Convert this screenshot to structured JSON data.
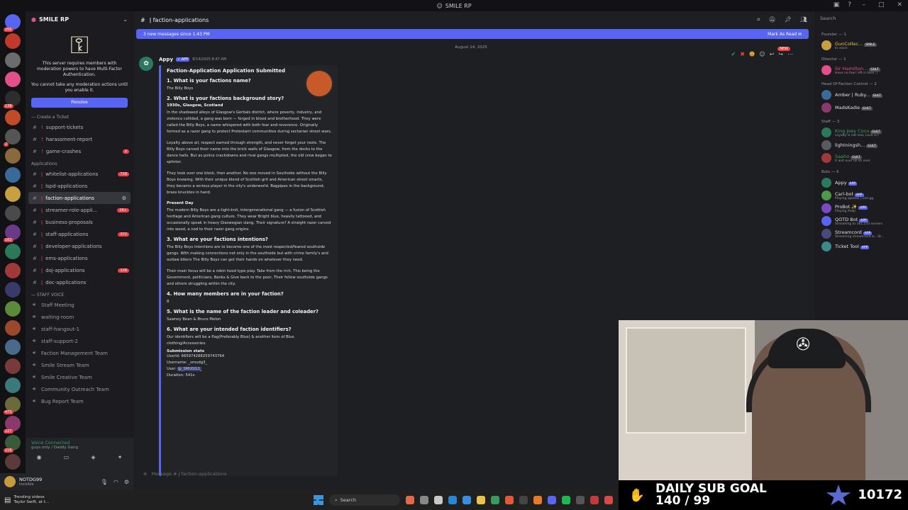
{
  "window": {
    "title": "SMILE RP"
  },
  "rail": {
    "servers": [
      {
        "badge": "250"
      },
      {
        "badge": ""
      },
      {
        "badge": ""
      },
      {
        "badge": ""
      },
      {
        "badge": "138"
      },
      {
        "badge": ""
      },
      {
        "badge": "2"
      },
      {
        "badge": ""
      },
      {
        "badge": ""
      },
      {
        "badge": ""
      },
      {
        "badge": ""
      },
      {
        "badge": "162"
      },
      {
        "badge": ""
      },
      {
        "badge": ""
      },
      {
        "badge": ""
      },
      {
        "badge": ""
      },
      {
        "badge": ""
      },
      {
        "badge": ""
      },
      {
        "badge": ""
      },
      {
        "badge": ""
      },
      {
        "badge": "473"
      },
      {
        "badge": "227"
      },
      {
        "badge": "216"
      },
      {
        "badge": ""
      }
    ]
  },
  "sidebar": {
    "server_name": "SMILE RP",
    "mfa_text_1": "This server requires members with moderation powers to have Multi-Factor Authentication.",
    "mfa_text_2": "You cannot take any moderation actions until you enable it.",
    "resolve_label": "Resolve",
    "cat_ticket": "Create a Ticket",
    "ticket_channels": [
      {
        "name": "support-tickets",
        "badge": ""
      },
      {
        "name": "harassment-report",
        "badge": ""
      },
      {
        "name": "game-crashes",
        "badge": "2"
      }
    ],
    "cat_apps": "Applications",
    "app_channels": [
      {
        "name": "whitelist-applications",
        "badge": "728"
      },
      {
        "name": "lspd-applications",
        "badge": ""
      },
      {
        "name": "faction-applications",
        "badge": ""
      },
      {
        "name": "streamer-role-appli...",
        "badge": "1K+"
      },
      {
        "name": "business-proposals",
        "badge": ""
      },
      {
        "name": "staff-applications",
        "badge": "372"
      },
      {
        "name": "developer-applications",
        "badge": ""
      },
      {
        "name": "ems-applications",
        "badge": ""
      },
      {
        "name": "doj-applications",
        "badge": "126"
      },
      {
        "name": "doc-applications",
        "badge": ""
      }
    ],
    "cat_voice": "STAFF VOICE",
    "voice_channels": [
      "Staff Meeting",
      "waiting-room",
      "staff-hangout-1",
      "staff-support-2",
      "Faction Management Team",
      "Smile Stream Team",
      "Smile Creative Team",
      "Community Outreach Team",
      "Bug Report Team"
    ]
  },
  "voice_bar": {
    "status": "Voice Connected",
    "sub": "guys only / Daddy Gang"
  },
  "user_bar": {
    "name": "NOTDG99",
    "status": "Invisible"
  },
  "channel": {
    "name": "faction-applications",
    "banner": "3 new messages since 1:43 PM",
    "mark_read": "Mark As Read",
    "date": "August 14, 2025",
    "composer_placeholder": "Message #",
    "composer_channel": "faction-applications"
  },
  "message": {
    "author": "Appy",
    "app_tag": "APP",
    "time": "8/14/2025 8:47 AM",
    "new_tag": "NEW",
    "embed_title": "Faction-Application Application Submitted",
    "q1": "1. What is your factions name?",
    "a1": "The Billy Boys",
    "q2": "2. What is your factions background story?",
    "a2_head": "1930s, Glasgow, Scotland",
    "a2_p1": "In the shadowed alleys of Glasgow's Gorbals district, where poverty, industry, and violence collided, a gang was born — forged in blood and brotherhood. They were called the Billy Boys, a name whispered with both fear and reverence. Originally formed as a razor gang to protect Protestant communities during sectarian street wars.",
    "a2_p2": "Loyalty above all, respect earned through strength, and never forget your roots. The Billy Boys carved their name into the brick walls of Glasgow, from the docks to the dance halls. But as police crackdowns and rival gangs multiplied, the old crew began to splinter.",
    "a2_p3": "They took over one block, then another. No one moved in Southside without the Billy Boys knowing. With their unique blend of Scottish grit and American street smarts, they became a serious player in the city's underworld. Bagpipes in the background, brass knuckles in hand.",
    "a2_head2": "Present Day",
    "a2_p4": "The modern Billy Boys are a tight-knit, intergenerational gang — a fusion of Scottish heritage and American gang culture. They wear Bright blue, heavily tattooed, and occasionally speak in heavy Glaswegian slang. Their signature? A straight razor carved into wood, a nod to their razor gang origins.",
    "q3": "3. What are your factions intentions?",
    "a3_p1": "The Billy Boys intentions are to become one of the most respected/feared southside gangs. With making connections not only in the southside but with crime family's and outlaw bikers The Billy Boys can get their hands on whatever they need.",
    "a3_p2": "Their main focus will be a robin hood type play. Take from the rich, This being the Government, politicians, Banks & Give back to the poor, Their fellow southside gangs and others struggling within the city.",
    "q4": "4. How many members are in your faction?",
    "a4": "8",
    "q5": "5. What is the name of the faction leader and coleader?",
    "a5": "Sawney Bean & Bruce Melon",
    "q6": "6. What are your intended faction identifiers?",
    "a6": "Our identifiers will be a flag(Preferably Blue) & another item of Blue clothing/Accessories.",
    "stats_title": "Submission stats",
    "stat_userid": "UserId: 665974288259743764",
    "stat_username": "Username: _smudg3_",
    "stat_user_label": "User: ",
    "stat_user_mention": "@_SMUDG3_",
    "stat_duration": "Duration: 541s"
  },
  "members": {
    "search_placeholder": "Search",
    "groups": [
      {
        "role": "Founder — 1",
        "list": [
          {
            "name": "GunCollec...",
            "tag": "SMILE",
            "status": "In voice",
            "color": "#e8c44a"
          }
        ]
      },
      {
        "role": "Director — 1",
        "list": [
          {
            "name": "Sir Hamilton...",
            "tag": "GULT",
            "status": "Have no fear! HR is here :)",
            "color": "#e24f8c"
          }
        ]
      },
      {
        "role": "Head Of Faction Control — 2",
        "list": [
          {
            "name": "Amber | Ruby...",
            "tag": "GULT",
            "status": "",
            "color": "#e2e2e2"
          },
          {
            "name": "MadsKadie",
            "tag": "GULT",
            "status": "",
            "color": "#e2e2e2"
          }
        ]
      },
      {
        "role": "Staff — 3",
        "list": [
          {
            "name": "King Joey Coco",
            "tag": "GULT",
            "status": "Loyalty is not real, Love is!!",
            "color": "#3ba55d"
          },
          {
            "name": "lightningsh...",
            "tag": "GULT",
            "status": "",
            "color": "#e2e2e2"
          },
          {
            "name": "Saaho",
            "tag": "GULT",
            "status": "it aint over till its over",
            "color": "#3ba55d"
          }
        ]
      },
      {
        "role": "Bots — 6",
        "list": [
          {
            "name": "Appy",
            "tag": "APP",
            "status": "",
            "color": "#e2e2e2"
          },
          {
            "name": "Carl-bot",
            "tag": "APP",
            "status": "Playing /games | carl.gg",
            "color": "#e2e2e2"
          },
          {
            "name": "ProBot ✨",
            "tag": "APP",
            "status": "Playing /help",
            "color": "#e2e2e2"
          },
          {
            "name": "QOTD Bot",
            "tag": "APP",
            "status": "Streaming to 161,533 servers",
            "color": "#e2e2e2"
          },
          {
            "name": "Streamcord",
            "tag": "APP",
            "status": "Streaming streamcord.io - St...",
            "color": "#e2e2e2"
          },
          {
            "name": "Ticket Tool",
            "tag": "APP",
            "status": "",
            "color": "#e2e2e2"
          }
        ]
      }
    ]
  },
  "overlay": {
    "goal_line1": "DAILY SUB GOAL",
    "goal_line2": "140 / 99",
    "count": "10172"
  },
  "taskbar": {
    "weather_line1": "Trending videos",
    "weather_line2": "Taylor Swift, at t...",
    "search": "Search"
  },
  "colors": {
    "accent": "#5865f2",
    "danger": "#f23f43",
    "voice": "#23a55a"
  }
}
